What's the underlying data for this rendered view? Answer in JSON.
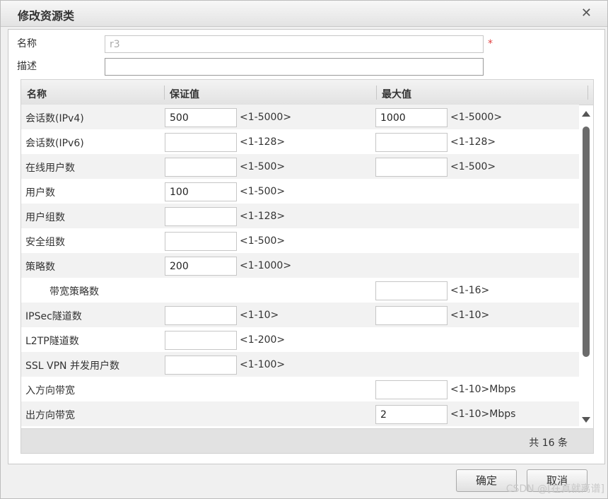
{
  "dialog": {
    "title": "修改资源类",
    "close_icon": "close-icon",
    "close_glyph": "✕"
  },
  "form": {
    "name_label": "名称",
    "name_value": "r3",
    "required_mark": "*",
    "desc_label": "描述",
    "desc_value": ""
  },
  "grid": {
    "headers": [
      "名称",
      "保证值",
      "最大值"
    ],
    "rows": [
      {
        "name": "会话数(IPv4)",
        "guaranteed": "500",
        "guaranteed_range": "<1-5000>",
        "max": "1000",
        "max_range": "<1-5000>"
      },
      {
        "name": "会话数(IPv6)",
        "guaranteed": "",
        "guaranteed_range": "<1-128>",
        "max": "",
        "max_range": "<1-128>"
      },
      {
        "name": "在线用户数",
        "guaranteed": "",
        "guaranteed_range": "<1-500>",
        "max": "",
        "max_range": "<1-500>"
      },
      {
        "name": "用户数",
        "guaranteed": "100",
        "guaranteed_range": "<1-500>"
      },
      {
        "name": "用户组数",
        "guaranteed": "",
        "guaranteed_range": "<1-128>"
      },
      {
        "name": "安全组数",
        "guaranteed": "",
        "guaranteed_range": "<1-500>"
      },
      {
        "name": "策略数",
        "guaranteed": "200",
        "guaranteed_range": "<1-1000>"
      },
      {
        "name": "带宽策略数",
        "indent": true,
        "max": "",
        "max_range": "<1-16>"
      },
      {
        "name": "IPSec隧道数",
        "guaranteed": "",
        "guaranteed_range": "<1-10>",
        "max": "",
        "max_range": "<1-10>"
      },
      {
        "name": "L2TP隧道数",
        "guaranteed": "",
        "guaranteed_range": "<1-200>"
      },
      {
        "name": "SSL VPN 并发用户数",
        "guaranteed": "",
        "guaranteed_range": "<1-100>"
      },
      {
        "name": "入方向带宽",
        "max": "",
        "max_range": "<1-10>Mbps"
      },
      {
        "name": "出方向带宽",
        "max": "2",
        "max_range": "<1-10>Mbps"
      }
    ],
    "total_text": "共 16 条",
    "scroll_up_icon": "scroll-up-icon",
    "scroll_down_icon": "scroll-down-icon"
  },
  "buttons": {
    "ok": "确定",
    "cancel": "取消"
  },
  "watermark": "CSDN @[在真就离谱]"
}
